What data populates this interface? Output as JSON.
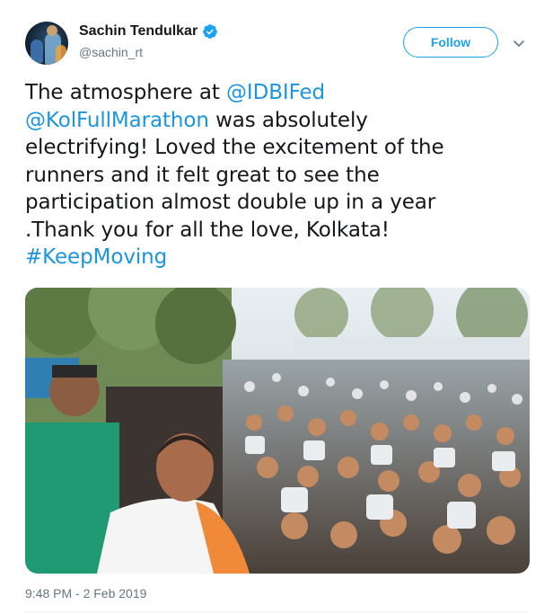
{
  "author": {
    "name": "Sachin Tendulkar",
    "handle": "@sachin_rt",
    "verified": true,
    "avatar_icon": "profile-photo"
  },
  "actions": {
    "follow_label": "Follow",
    "more_icon": "chevron-down-icon"
  },
  "tweet": {
    "line1_prefix": "The atmosphere at ",
    "mention1": "@IDBIFed",
    "mention2": "@KolFullMarathon",
    "line2_suffix": " was absolutely",
    "line3": "electrifying! Loved the excitement of the",
    "line4": "runners and it felt great to see the",
    "line5": "participation almost double up in a year",
    "line6": ".Thank you for all the love, Kolkata!",
    "hashtag": "#KeepMoving"
  },
  "media": {
    "type": "photo",
    "subject": "marathon-selfie-crowd"
  },
  "meta": {
    "timestamp": "9:48 PM - 2 Feb 2019"
  },
  "colors": {
    "link": "#1b95e0",
    "follow": "#1da1f2",
    "secondary_text": "#657786",
    "verified": "#1da1f2"
  }
}
